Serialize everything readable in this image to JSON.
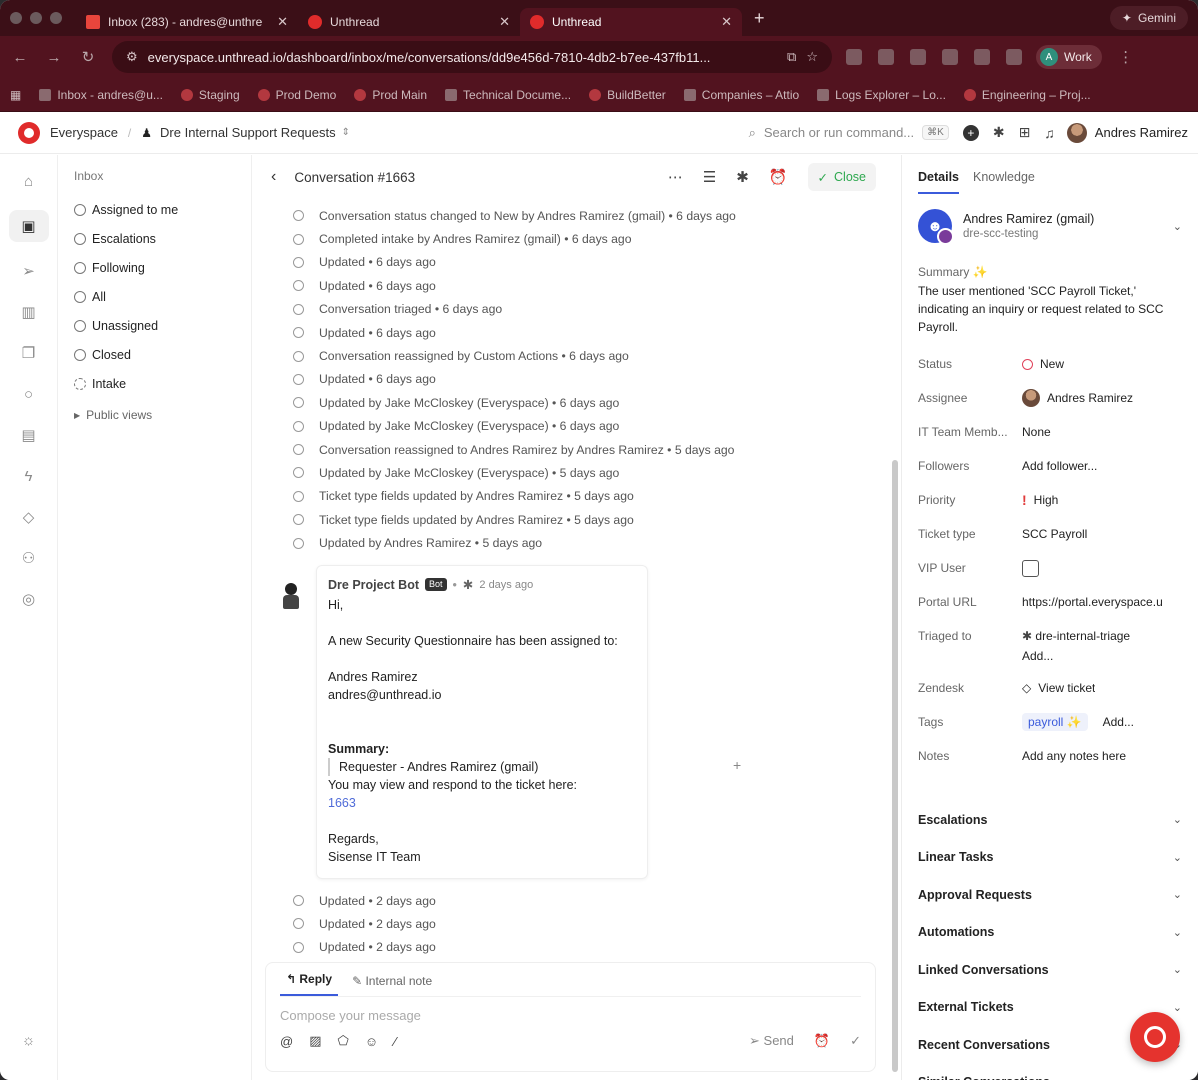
{
  "browser": {
    "tabs": [
      {
        "title": "Inbox (283) - andres@unthre",
        "icon": "gmail-icon"
      },
      {
        "title": "Unthread",
        "icon": "unthread-icon"
      },
      {
        "title": "Unthread",
        "icon": "unthread-icon"
      }
    ],
    "gemini": "Gemini",
    "url": "everyspace.unthread.io/dashboard/inbox/me/conversations/dd9e456d-7810-4db2-b7ee-437fb11...",
    "profile_initial": "A",
    "profile_label": "Work",
    "bookmarks": [
      "Inbox - andres@u...",
      "Staging",
      "Prod Demo",
      "Prod Main",
      "Technical Docume...",
      "BuildBetter",
      "Companies – Attio",
      "Logs Explorer – Lo...",
      "Engineering – Proj..."
    ]
  },
  "header": {
    "workspace": "Everyspace",
    "project": "Dre Internal Support Requests",
    "search_placeholder": "Search or run command...",
    "shortcut": "⌘K",
    "user": "Andres Ramirez"
  },
  "inbox": {
    "label": "Inbox",
    "items": [
      "Assigned to me",
      "Escalations",
      "Following",
      "All",
      "Unassigned",
      "Closed",
      "Intake"
    ],
    "public_views": "Public views"
  },
  "conversation": {
    "title": "Conversation #1663",
    "close_label": "Close",
    "events_before": [
      "Conversation status changed to New by Andres Ramirez (gmail) • 6 days ago",
      "Completed intake by Andres Ramirez (gmail) • 6 days ago",
      "Updated • 6 days ago",
      "Updated • 6 days ago",
      "Conversation triaged • 6 days ago",
      "Updated • 6 days ago",
      "Conversation reassigned by Custom Actions • 6 days ago",
      "Updated • 6 days ago",
      "Updated by Jake McCloskey (Everyspace) • 6 days ago",
      "Updated by Jake McCloskey (Everyspace) • 6 days ago",
      "Conversation reassigned to Andres Ramirez by Andres Ramirez • 5 days ago",
      "Updated by Jake McCloskey (Everyspace) • 5 days ago",
      "Ticket type fields updated by Andres Ramirez • 5 days ago",
      "Ticket type fields updated by Andres Ramirez • 5 days ago",
      "Updated by Andres Ramirez • 5 days ago"
    ],
    "message": {
      "sender": "Dre Project Bot",
      "badge": "Bot",
      "time": "2 days ago",
      "greeting": "Hi,",
      "line1": "A new Security Questionnaire has been assigned to:",
      "assignee_name": "Andres Ramirez",
      "assignee_email": "andres@unthread.io",
      "summary_label": "Summary:",
      "requester": "Requester - Andres Ramirez (gmail)",
      "view_line": "You may view and respond to the ticket here:",
      "ticket_link": "1663",
      "regards": "Regards,",
      "team": "Sisense IT Team"
    },
    "events_after": [
      "Updated • 2 days ago",
      "Updated • 2 days ago",
      "Updated • 2 days ago"
    ],
    "composer": {
      "reply_tab": "Reply",
      "note_tab": "Internal note",
      "placeholder": "Compose your message",
      "send": "Send"
    }
  },
  "details": {
    "tab_details": "Details",
    "tab_knowledge": "Knowledge",
    "requester_name": "Andres Ramirez (gmail)",
    "requester_sub": "dre-scc-testing",
    "summary_label": "Summary ✨",
    "summary_text": "The user mentioned 'SCC Payroll Ticket,' indicating an inquiry or request related to SCC Payroll.",
    "fields": {
      "status_k": "Status",
      "status_v": "New",
      "assignee_k": "Assignee",
      "assignee_v": "Andres Ramirez",
      "itteam_k": "IT Team Memb...",
      "itteam_v": "None",
      "followers_k": "Followers",
      "followers_v": "Add follower...",
      "priority_k": "Priority",
      "priority_v": "High",
      "ticket_k": "Ticket type",
      "ticket_v": "SCC Payroll",
      "vip_k": "VIP User",
      "portal_k": "Portal URL",
      "portal_v": "https://portal.everyspace.u",
      "triaged_k": "Triaged to",
      "triaged_v": "dre-internal-triage",
      "triaged_add": "Add...",
      "zendesk_k": "Zendesk",
      "zendesk_v": "View ticket",
      "tags_k": "Tags",
      "tags_v": "payroll ✨",
      "tags_add": "Add...",
      "notes_k": "Notes",
      "notes_placeholder": "Add any notes here"
    },
    "sections": [
      "Escalations",
      "Linear Tasks",
      "Approval Requests",
      "Automations",
      "Linked Conversations",
      "External Tickets",
      "Recent Conversations",
      "Similar Conversations"
    ]
  }
}
